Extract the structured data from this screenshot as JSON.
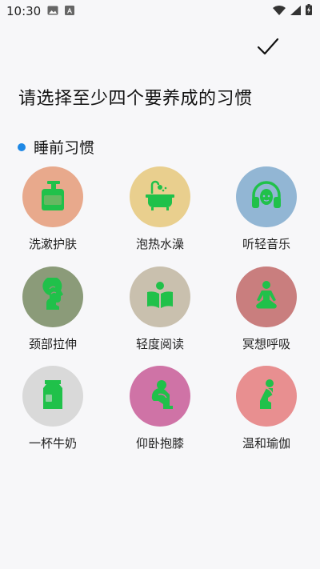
{
  "status": {
    "time": "10:30"
  },
  "header": {
    "title": "请选择至少四个要养成的习惯"
  },
  "section": {
    "title": "睡前习惯"
  },
  "habits": [
    {
      "label": "洗漱护肤",
      "icon": "lotion-bottle-icon",
      "color": "#e8a98c"
    },
    {
      "label": "泡热水澡",
      "icon": "bathtub-icon",
      "color": "#e9cf8e"
    },
    {
      "label": "听轻音乐",
      "icon": "headphones-icon",
      "color": "#92b6d4"
    },
    {
      "label": "颈部拉伸",
      "icon": "neck-stretch-icon",
      "color": "#8b9b79"
    },
    {
      "label": "轻度阅读",
      "icon": "book-icon",
      "color": "#c9c0ae"
    },
    {
      "label": "冥想呼吸",
      "icon": "meditation-icon",
      "color": "#c97e7e"
    },
    {
      "label": "一杯牛奶",
      "icon": "milk-carton-icon",
      "color": "#d9d9d9"
    },
    {
      "label": "仰卧抱膝",
      "icon": "hug-knees-icon",
      "color": "#cf73a6"
    },
    {
      "label": "温和瑜伽",
      "icon": "yoga-icon",
      "color": "#e88f90"
    }
  ],
  "colors": {
    "accent": "#1e88e5",
    "icon_green": "#20c14a"
  }
}
